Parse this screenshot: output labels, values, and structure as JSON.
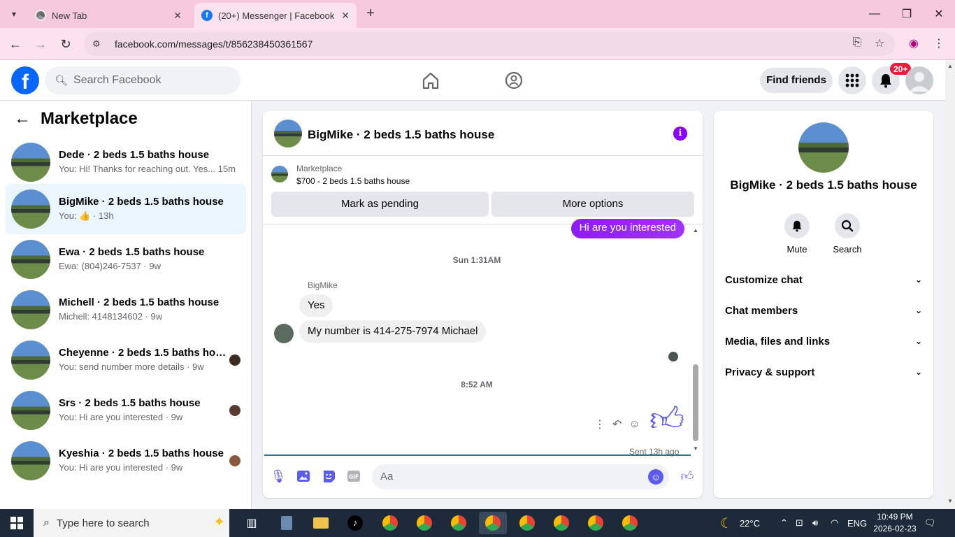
{
  "browser": {
    "tabs": [
      {
        "title": "New Tab",
        "active": false
      },
      {
        "title": "(20+) Messenger | Facebook",
        "active": true
      }
    ],
    "url": "facebook.com/messages/t/856238450361567"
  },
  "fb": {
    "search_placeholder": "Search Facebook",
    "find_friends": "Find friends",
    "notif_badge": "20+"
  },
  "sidebar": {
    "title": "Marketplace",
    "conversations": [
      {
        "name": "Dede · 2 beds 1.5 baths house",
        "preview": "You: Hi! Thanks for reaching out. Yes...",
        "time": "15m",
        "selected": false
      },
      {
        "name": "BigMike · 2 beds 1.5 baths house",
        "preview": "You: 👍 · 13h",
        "selected": true
      },
      {
        "name": "Ewa · 2 beds 1.5 baths house",
        "preview": "Ewa: (804)246-7537 · 9w",
        "selected": false
      },
      {
        "name": "Michell · 2 beds 1.5 baths house",
        "preview": "Michell: 4148134602 · 9w",
        "selected": false
      },
      {
        "name": "Cheyenne · 2 beds 1.5 baths hou...",
        "preview": "You: send number more details · 9w",
        "selected": false
      },
      {
        "name": "Srs · 2 beds 1.5 baths house",
        "preview": "You: Hi are you interested · 9w",
        "selected": false
      },
      {
        "name": "Kyeshia · 2 beds 1.5 baths house",
        "preview": "You: Hi are you interested · 9w",
        "selected": false
      }
    ]
  },
  "chat": {
    "title": "BigMike · 2 beds 1.5 baths house",
    "marketplace_label": "Marketplace",
    "listing": "$700 - 2 beds 1.5 baths house",
    "mark_pending": "Mark as pending",
    "more_options": "More options",
    "outgoing_top": "Hi are you interested",
    "timestamp1": "Sun 1:31AM",
    "sender": "BigMike",
    "msg1": "Yes",
    "msg2": "My number is 414-275-7974  Michael",
    "timestamp2": "8:52 AM",
    "sent_status": "Sent 13h ago",
    "composer_placeholder": "Aa"
  },
  "right_panel": {
    "name": "BigMike · 2 beds 1.5 baths house",
    "mute": "Mute",
    "search": "Search",
    "sections": [
      "Customize chat",
      "Chat members",
      "Media, files and links",
      "Privacy & support"
    ]
  },
  "taskbar": {
    "search_placeholder": "Type here to search",
    "weather": "22°C",
    "lang": "ENG",
    "time": "10:49 PM",
    "date": "2026-02-23"
  },
  "colors": {
    "fb_blue": "#0866ff",
    "messenger_purple": "#8a00ff",
    "notif_red": "#e41e3f"
  }
}
